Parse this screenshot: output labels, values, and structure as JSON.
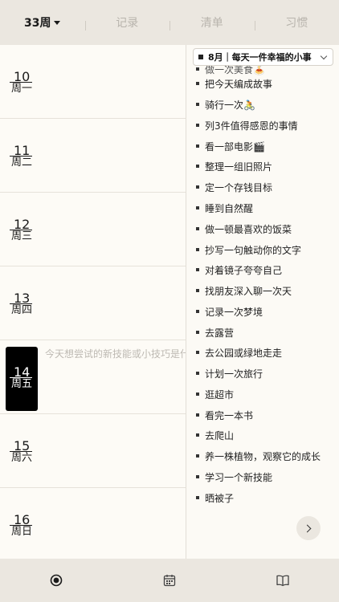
{
  "tabs": [
    {
      "label": "33周",
      "active": true
    },
    {
      "label": "记录",
      "active": false
    },
    {
      "label": "清单",
      "active": false
    },
    {
      "label": "习惯",
      "active": false
    }
  ],
  "days": [
    {
      "num": "10",
      "week": "周一"
    },
    {
      "num": "11",
      "week": "周二"
    },
    {
      "num": "12",
      "week": "周三"
    },
    {
      "num": "13",
      "week": "周四"
    },
    {
      "num": "14",
      "week": "周五",
      "today": true,
      "prompt": "今天想尝试的新技能或小技巧是什么"
    },
    {
      "num": "15",
      "week": "周六"
    },
    {
      "num": "16",
      "week": "周日"
    }
  ],
  "category": {
    "label": "8月｜每天一件幸福的小事"
  },
  "list_items": [
    "做一次美食🍝",
    "把今天编成故事",
    "骑行一次🚴",
    "列3件值得感恩的事情",
    "看一部电影🎬",
    "整理一组旧照片",
    "定一个存钱目标",
    "睡到自然醒",
    "做一顿最喜欢的饭菜",
    "抄写一句触动你的文字",
    "对着镜子夸夸自己",
    "找朋友深入聊一次天",
    "记录一次梦境",
    "去露营",
    "去公园或绿地走走",
    "计划一次旅行",
    "逛超市",
    "看完一本书",
    "去爬山",
    "养一株植物，观察它的成长",
    "学习一个新技能",
    "晒被子"
  ],
  "icons": {
    "bottom": [
      "record-circle-icon",
      "calendar-icon",
      "book-icon"
    ],
    "next": "chevron-right-icon"
  }
}
